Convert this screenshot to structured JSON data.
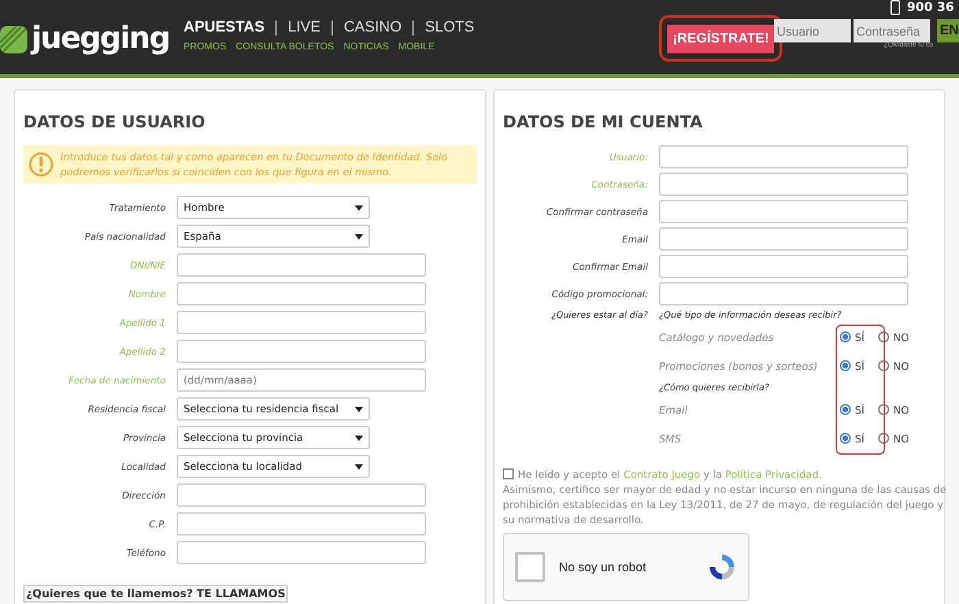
{
  "header": {
    "logo_text": "juegging",
    "nav_main": [
      {
        "label": "APUESTAS",
        "selected": true
      },
      {
        "label": "LIVE",
        "selected": false
      },
      {
        "label": "CASINO",
        "selected": false
      },
      {
        "label": "SLOTS",
        "selected": false
      }
    ],
    "nav_sub": [
      "PROMOS",
      "CONSULTA BOLETOS",
      "NOTICIAS",
      "MOBILE"
    ],
    "register_button": "¡REGÍSTRATE!",
    "phone": "900 36",
    "login": {
      "user_placeholder": "Usuario",
      "password_placeholder": "Contraseña",
      "submit": "EN",
      "forgot": "¿Olvidaste tu co"
    }
  },
  "user_panel": {
    "title": "DATOS DE USUARIO",
    "notice": "Introduce tus datos tal y como aparecen en tu Documento de Identidad. Solo podremos verificarlos si coinciden con los que figura en el mismo.",
    "fields": [
      {
        "label": "Tratamiento",
        "kind": "select",
        "value": "Hombre",
        "required": false
      },
      {
        "label": "País nacionalidad",
        "kind": "select",
        "value": "España",
        "required": false
      },
      {
        "label": "DNI/NIE",
        "kind": "text",
        "required": true
      },
      {
        "label": "Nombre",
        "kind": "text",
        "required": true
      },
      {
        "label": "Apellido 1",
        "kind": "text",
        "required": true
      },
      {
        "label": "Apellido 2",
        "kind": "text",
        "required": true
      },
      {
        "label": "Fecha de nacimiento",
        "kind": "text",
        "placeholder": "(dd/mm/aaaa)",
        "required": true
      },
      {
        "label": "Residencia fiscal",
        "kind": "select",
        "value": "Selecciona tu residencia fiscal",
        "required": false
      },
      {
        "label": "Provincia",
        "kind": "select",
        "value": "Selecciona tu provincia",
        "required": false
      },
      {
        "label": "Localidad",
        "kind": "select",
        "value": "Selecciona tu localidad",
        "required": false
      },
      {
        "label": "Dirección",
        "kind": "text",
        "required": false
      },
      {
        "label": "C.P.",
        "kind": "text",
        "required": false
      },
      {
        "label": "Teléfono",
        "kind": "text",
        "required": false
      }
    ],
    "callback_button": "¿Quieres que te llamemos? TE LLAMAMOS"
  },
  "account_panel": {
    "title": "DATOS DE MI CUENTA",
    "fields": [
      {
        "label": "Usuario:",
        "required": true
      },
      {
        "label": "Contraseña:",
        "required": true
      },
      {
        "label": "Confirmar contraseña",
        "required": false
      },
      {
        "label": "Email",
        "required": false
      },
      {
        "label": "Confirmar Email",
        "required": false
      },
      {
        "label": "Código promocional:",
        "required": false
      }
    ],
    "stay_label": "¿Quieres estar al día?",
    "info_question": "¿Qué tipo de información deseas recibir?",
    "info_options": [
      {
        "label": "Catálogo y novedades",
        "choices": [
          {
            "label": "SÍ",
            "selected": true
          },
          {
            "label": "NO",
            "selected": false
          }
        ]
      },
      {
        "label": "Promociones (bonos y sorteos)",
        "choices": [
          {
            "label": "SÍ",
            "selected": true
          },
          {
            "label": "NO",
            "selected": false
          }
        ]
      }
    ],
    "channel_question": "¿Cómo quieres recibirla?",
    "channels": [
      {
        "label": "Email",
        "choices": [
          {
            "label": "SÍ",
            "selected": true
          },
          {
            "label": "NO",
            "selected": false
          }
        ]
      },
      {
        "label": "SMS",
        "choices": [
          {
            "label": "SÍ",
            "selected": true
          },
          {
            "label": "NO",
            "selected": false
          }
        ]
      }
    ],
    "consent": {
      "checked": false,
      "parts": [
        {
          "kind": "text",
          "text": "He leído y acepto el "
        },
        {
          "kind": "link",
          "text": "Contrato Juego"
        },
        {
          "kind": "text",
          "text": " y la "
        },
        {
          "kind": "link",
          "text": "Política Privacidad"
        },
        {
          "kind": "text",
          "text": "."
        }
      ],
      "note": "Asimismo, certifico ser mayor de edad y no estar incurso en ninguna de las causas de prohibición establecidas en la Ley 13/2011, de 27 de mayo, de regulación del juego y su normativa de desarrollo."
    },
    "captcha": {
      "label": "No soy un robot",
      "checked": false
    }
  }
}
